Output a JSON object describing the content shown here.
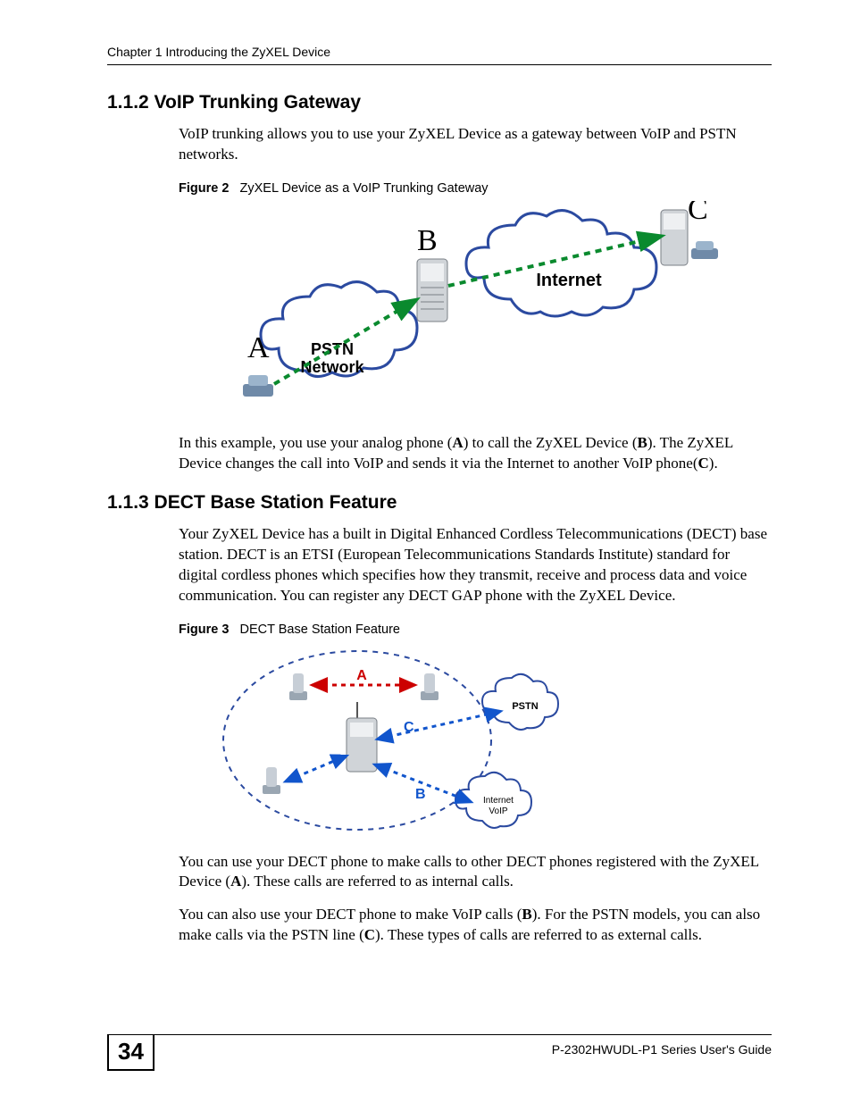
{
  "header": {
    "chapter": "Chapter 1 Introducing the ZyXEL Device"
  },
  "section112": {
    "heading": "1.1.2  VoIP Trunking Gateway",
    "p1": "VoIP trunking allows you to use your ZyXEL Device as a gateway between VoIP and PSTN networks.",
    "fig_label": "Figure 2",
    "fig_caption": "ZyXEL Device as a VoIP Trunking Gateway",
    "fig_labels": {
      "A": "A",
      "B": "B",
      "C": "C",
      "internet": "Internet",
      "pstn1": "PSTN",
      "pstn2": "Network"
    },
    "p2_a": "In this example, you use your analog phone (",
    "p2_b": ") to call the ZyXEL Device (",
    "p2_c": "). The ZyXEL Device changes the call into VoIP and sends it via the Internet to another VoIP phone(",
    "p2_d": ").",
    "A": "A",
    "B": "B",
    "C": "C"
  },
  "section113": {
    "heading": "1.1.3  DECT Base Station Feature",
    "p1": "Your ZyXEL Device has a built in Digital Enhanced Cordless Telecommunications (DECT) base station. DECT is an ETSI (European Telecommunications Standards Institute) standard for digital cordless phones which specifies how they transmit, receive and process data and voice communication. You can register any DECT GAP phone with the ZyXEL Device.",
    "fig_label": "Figure 3",
    "fig_caption": "DECT Base Station Feature",
    "fig_labels": {
      "A": "A",
      "B": "B",
      "C": "C",
      "pstn": "PSTN",
      "internet": "Internet",
      "voip": "VoIP"
    },
    "p2_a": "You can use your DECT phone to make calls to other DECT phones registered with the ZyXEL Device (",
    "p2_b": "). These calls are referred to as internal calls.",
    "A": "A",
    "p3_a": "You can also use your DECT phone to make VoIP calls (",
    "p3_b": "). For the PSTN models, you can also make calls via the PSTN line (",
    "p3_c": "). These types of calls are referred to as external calls.",
    "B": "B",
    "C": "C"
  },
  "footer": {
    "page": "34",
    "guide": "P-2302HWUDL-P1 Series User's Guide"
  }
}
